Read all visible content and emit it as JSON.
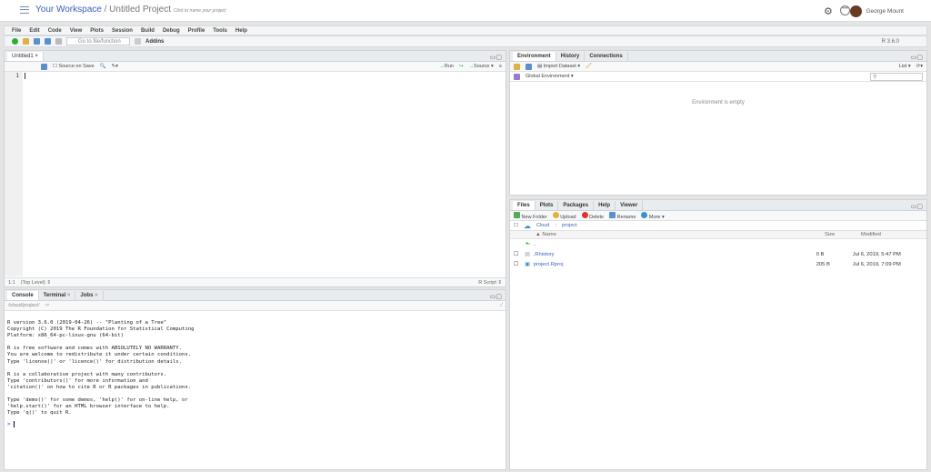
{
  "header": {
    "workspace": "Your Workspace",
    "separator": "/",
    "project": "Untitled Project",
    "project_hint": "Click to name your project",
    "user": "George Mount"
  },
  "menu": [
    "File",
    "Edit",
    "Code",
    "View",
    "Plots",
    "Session",
    "Build",
    "Debug",
    "Profile",
    "Tools",
    "Help"
  ],
  "toolbar": {
    "goto_placeholder": "Go to file/function",
    "addins": "Addins",
    "r_version": "R 3.6.0"
  },
  "editor": {
    "tab": "Untitled1",
    "source_on_save": "Source on Save",
    "run": "Run",
    "source": "Source",
    "line_number": "1",
    "position": "1:1",
    "scope": "(Top Level)",
    "file_type": "R Script"
  },
  "console": {
    "tabs": [
      "Console",
      "Terminal",
      "Jobs"
    ],
    "path": "/cloud/project/",
    "output": "R version 3.6.0 (2019-04-26) -- \"Planting of a Tree\"\nCopyright (C) 2019 The R Foundation for Statistical Computing\nPlatform: x86_64-pc-linux-gnu (64-bit)\n\nR is free software and comes with ABSOLUTELY NO WARRANTY.\nYou are welcome to redistribute it under certain conditions.\nType 'license()' or 'licence()' for distribution details.\n\nR is a collaborative project with many contributors.\nType 'contributors()' for more information and\n'citation()' on how to cite R or R packages in publications.\n\nType 'demo()' for some demos, 'help()' for on-line help, or\n'help.start()' for an HTML browser interface to help.\nType 'q()' to quit R.",
    "prompt": ">"
  },
  "environment": {
    "tabs": [
      "Environment",
      "History",
      "Connections"
    ],
    "import_dataset": "Import Dataset",
    "list": "List",
    "scope": "Global Environment",
    "empty": "Environment is empty"
  },
  "files": {
    "tabs": [
      "Files",
      "Plots",
      "Packages",
      "Help",
      "Viewer"
    ],
    "actions": [
      "New Folder",
      "Upload",
      "Delete",
      "Rename",
      "More"
    ],
    "breadcrumb": [
      "Cloud",
      "project"
    ],
    "columns": [
      "Name",
      "Size",
      "Modified"
    ],
    "parent": "..",
    "rows": [
      {
        "name": ".Rhistory",
        "size": "0 B",
        "modified": "Jul 6, 2019, 5:47 PM"
      },
      {
        "name": "project.Rproj",
        "size": "205 B",
        "modified": "Jul 6, 2019, 7:09 PM"
      }
    ]
  }
}
